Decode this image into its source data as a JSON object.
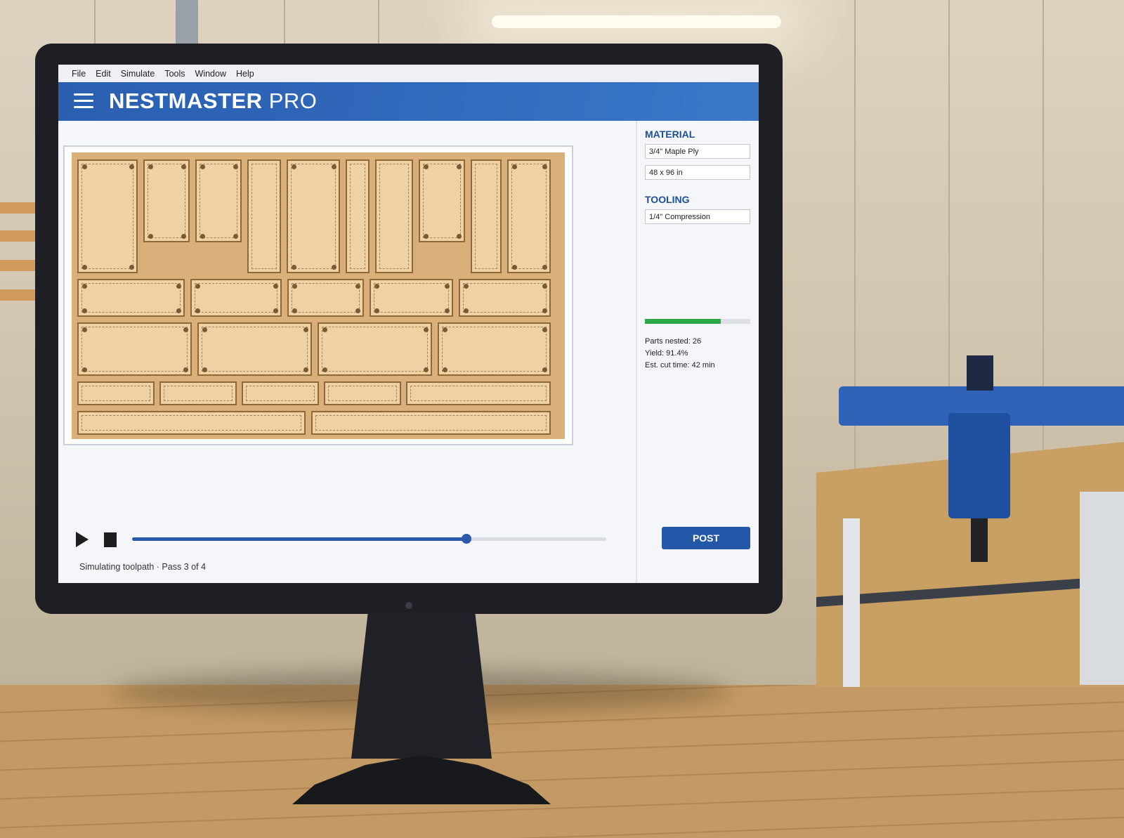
{
  "menu": [
    "File",
    "Edit",
    "Simulate",
    "Tools",
    "Window",
    "Help"
  ],
  "app": {
    "title_bold": "NESTMASTER",
    "title_light": "PRO"
  },
  "sidebar": {
    "material_heading": "MATERIAL",
    "material_value": "3/4\" Maple Ply",
    "sheet_size": "48 x 96 in",
    "tooling_heading": "TOOLING",
    "tool_value": "1/4\" Compression",
    "progress_fraction": 0.72,
    "stats": [
      "Parts nested: 26",
      "Yield: 91.4%",
      "Est. cut time: 42 min"
    ]
  },
  "playback": {
    "position_fraction": 0.705,
    "status": "Simulating toolpath · Pass 3 of 4"
  },
  "actions": {
    "post_label": "POST"
  },
  "colors": {
    "accent": "#2a5fb0",
    "progress": "#2aa84a",
    "sheet": "#d9b07a",
    "part": "#eed2a4"
  }
}
